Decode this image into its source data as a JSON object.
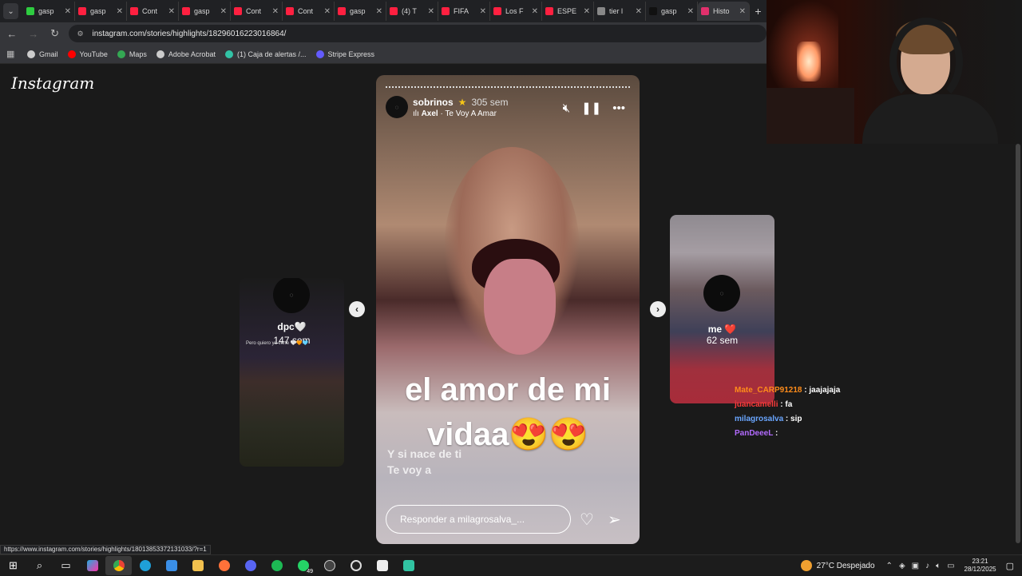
{
  "browser": {
    "tabs": [
      {
        "label": "gasp",
        "color": "#2ecc40"
      },
      {
        "label": "gasp",
        "color": "#ff2040"
      },
      {
        "label": "Cont",
        "color": "#ff2040"
      },
      {
        "label": "gasp",
        "color": "#ff2040"
      },
      {
        "label": "Cont",
        "color": "#ff2040"
      },
      {
        "label": "Cont",
        "color": "#ff2040"
      },
      {
        "label": "gasp",
        "color": "#ff2040"
      },
      {
        "label": "(4) T",
        "color": "#ff2040"
      },
      {
        "label": "FIFA",
        "color": "#ff2040"
      },
      {
        "label": "Los F",
        "color": "#ff2040"
      },
      {
        "label": "ESPE",
        "color": "#ff2040"
      },
      {
        "label": "tier l",
        "color": "#888888"
      },
      {
        "label": "gasp",
        "color": "#111111"
      },
      {
        "label": "Histo",
        "color": "#e1306c"
      }
    ],
    "url": "instagram.com/stories/highlights/18296016223016864/",
    "bookmarks": [
      {
        "label": "Gmail",
        "color": "#cccccc"
      },
      {
        "label": "YouTube",
        "color": "#ff0000"
      },
      {
        "label": "Maps",
        "color": "#34a853"
      },
      {
        "label": "Adobe Acrobat",
        "color": "#cccccc"
      },
      {
        "label": "(1) Caja de alertas /...",
        "color": "#32c3a6"
      },
      {
        "label": "Stripe Express",
        "color": "#635bff"
      }
    ],
    "status_url": "https://www.instagram.com/stories/highlights/18013853372131033/?r=1"
  },
  "instagram": {
    "logo": "Instagram",
    "main_story": {
      "username": "sobrinos",
      "age": "305 sem",
      "song_artist": "Axel",
      "song_title": "Te Voy A Amar",
      "song_prefix": "ılı",
      "song_sep": "·",
      "caption_line1": "el amor de mi",
      "caption_line2": "vidaa😍😍",
      "lyric_line1": "Y si nace de ti",
      "lyric_line2": "Te voy a",
      "reply_placeholder": "Responder a milagrosalva_..."
    },
    "left_story": {
      "name": "dpc🤍",
      "age": "147 sem",
      "caption": "Pero quiero ya verte 🤍🧡🩵"
    },
    "right_story": {
      "name": "me ❤️",
      "age": "62 sem"
    }
  },
  "chat": [
    {
      "user": "Mate_CARP91218",
      "sep": " : ",
      "text": "jaajajaja",
      "color": "#ff8c1a"
    },
    {
      "user": "juancamelli",
      "sep": " : ",
      "text": "fa",
      "color": "#ff3b3b"
    },
    {
      "user": "milagrosalva",
      "sep": " : ",
      "text": "sip",
      "color": "#6aa6ff"
    },
    {
      "user": "PanDeeeL",
      "sep": " : ",
      "text": "",
      "color": "#b36bff"
    }
  ],
  "taskbar": {
    "whatsapp_badge": "49",
    "weather_text": "27°C  Despejado",
    "time": "23:21",
    "date": "28/12/2025"
  }
}
